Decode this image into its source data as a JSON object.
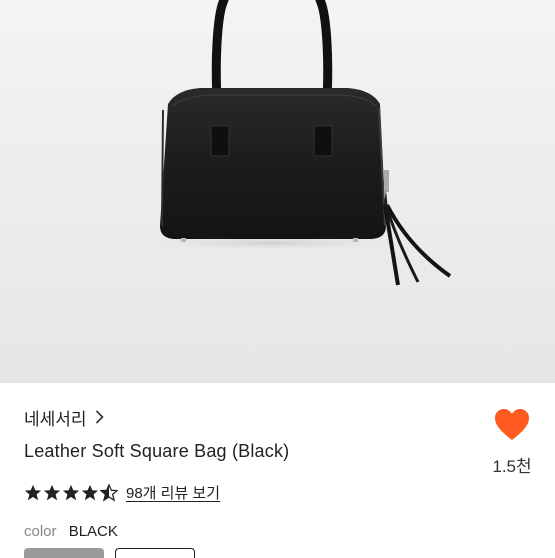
{
  "product": {
    "brand": "네세서리",
    "brand_chevron_icon": "chevron-right-icon",
    "title": "Leather Soft Square Bag (Black)",
    "like_icon": "heart-icon",
    "like_color": "#ff5a1f",
    "like_count": "1.5천",
    "rating": 4.5,
    "rating_max": 5,
    "review_link": "98개 리뷰 보기",
    "color_label": "color",
    "color_value": "BLACK"
  }
}
